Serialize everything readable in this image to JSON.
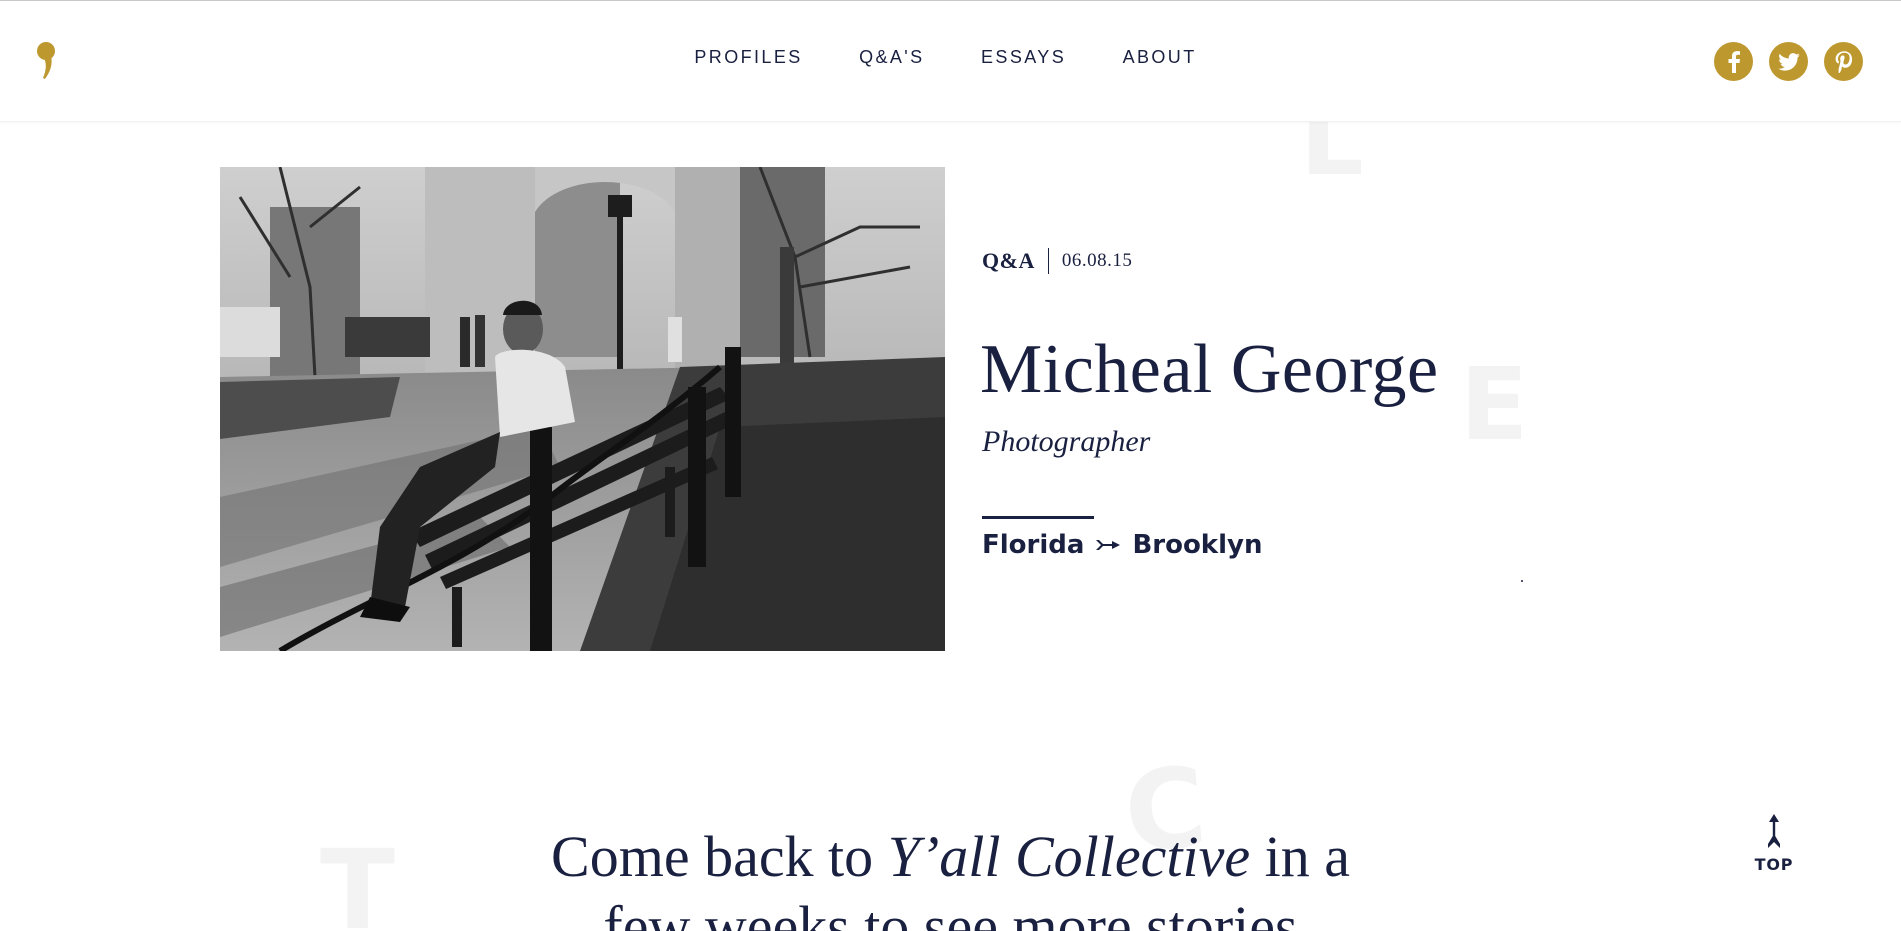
{
  "header": {
    "nav": [
      "PROFILES",
      "Q&A'S",
      "ESSAYS",
      "ABOUT"
    ],
    "social": [
      {
        "name": "facebook",
        "glyph": "f"
      },
      {
        "name": "twitter",
        "glyph": "twitter-bird"
      },
      {
        "name": "pinterest",
        "glyph": "p"
      }
    ]
  },
  "profile": {
    "type": "Q&A",
    "date": "06.08.15",
    "name": "Micheal George",
    "role": "Photographer",
    "from": "Florida",
    "to": "Brooklyn"
  },
  "watermarks": [
    "L",
    "E",
    "C",
    "T"
  ],
  "footer_message": {
    "lead": "Come back to ",
    "brand": "Y’all Collective",
    "tail": " in a",
    "line2": "few weeks to see more stories"
  },
  "top_button": {
    "label": "TOP"
  },
  "colors": {
    "accent": "#bd982e",
    "text": "#1a2040"
  }
}
